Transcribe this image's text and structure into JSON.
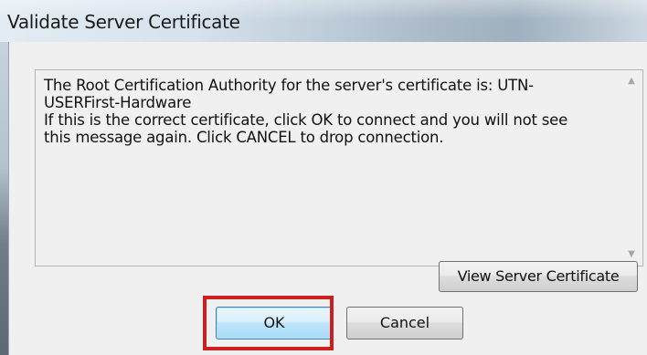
{
  "window": {
    "title": "Validate Server Certificate"
  },
  "message": {
    "text": "The Root Certification Authority for the server's certificate is: UTN-\nUSERFirst-Hardware\nIf this is the correct certificate, click OK to connect and you will not see\nthis message again.  Click CANCEL to drop connection.",
    "scroll_up_icon": "scroll-up-arrow",
    "scroll_down_icon": "scroll-down-arrow"
  },
  "buttons": {
    "view_certificate": "View Server Certificate",
    "ok": "OK",
    "cancel": "Cancel"
  },
  "colors": {
    "highlight": "#cc1f1f",
    "default_button_border": "#3c7fb1"
  }
}
